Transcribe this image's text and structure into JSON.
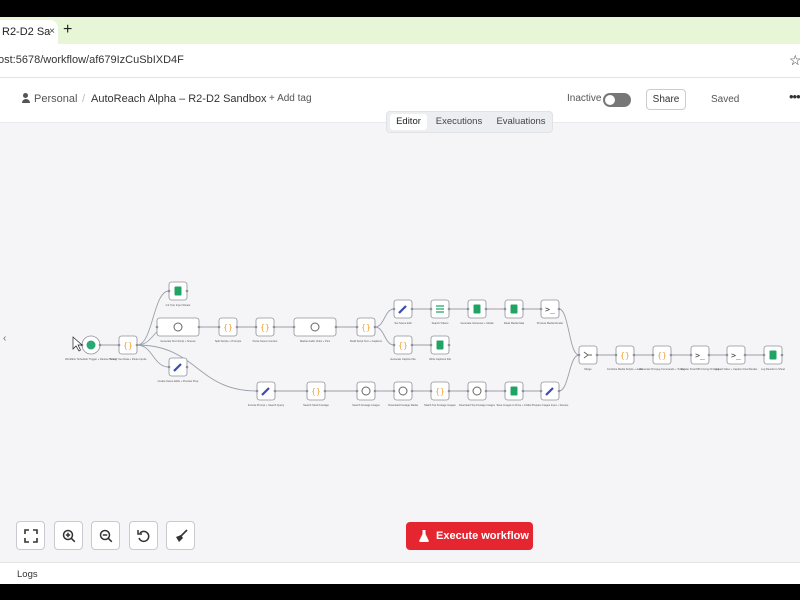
{
  "browser": {
    "tab_title": "R2-D2 Sa",
    "new_tab": "+",
    "close_glyph": "×",
    "url": "ost:5678/workflow/af679IzCuSbIXD4F",
    "bookmark_glyph": "☆"
  },
  "header": {
    "workspace": "Personal",
    "separator": "/",
    "workflow_title": "AutoReach Alpha – R2-D2 Sandbox",
    "add_tag": "+ Add tag",
    "status": "Inactive",
    "share": "Share",
    "saved": "Saved",
    "more_glyph": "•••"
  },
  "modes": [
    {
      "label": "Editor",
      "active": true
    },
    {
      "label": "Executions",
      "active": false
    },
    {
      "label": "Evaluations",
      "active": false
    }
  ],
  "canvas": {
    "collapse_glyph": "‹",
    "nodes": [
      {
        "kind": "trigger",
        "label": "Workflow 'Schedule' Trigger + Review Timing"
      },
      {
        "kind": "code",
        "label": "Select Your Data + Parse Inputs"
      },
      {
        "kind": "sheets",
        "label": "Init Your Input Sheets"
      },
      {
        "kind": "http",
        "label": "Generate Text Script + Scenes"
      },
      {
        "kind": "edit",
        "label": "Create Scene Edits + Preview Prep"
      },
      {
        "kind": "code",
        "label": "Split Scripts + Prompts"
      },
      {
        "kind": "code",
        "label": "Parse Scene Content"
      },
      {
        "kind": "http",
        "label": "Market Audio Voice + Pics"
      },
      {
        "kind": "code",
        "label": "Build Script Text + Captions"
      },
      {
        "kind": "edit",
        "label": "Set Scene Edit"
      },
      {
        "kind": "filter",
        "label": "Search Videos"
      },
      {
        "kind": "split",
        "label": "Generate Voiceover + Media"
      },
      {
        "kind": "sheets",
        "label": "Read Media Data"
      },
      {
        "kind": "exec",
        "label": "Process Media Render"
      },
      {
        "kind": "code",
        "label": "Generate Caption File"
      },
      {
        "kind": "sheets",
        "label": "Write Captions File"
      },
      {
        "kind": "edit",
        "label": "Format Prompt + Search Query"
      },
      {
        "kind": "code",
        "label": "Search Stock Footage"
      },
      {
        "kind": "http",
        "label": "Search Footage Images"
      },
      {
        "kind": "http",
        "label": "Download Footage Media"
      },
      {
        "kind": "code",
        "label": "Match Top Footage Images"
      },
      {
        "kind": "http",
        "label": "Download Top Footage Images"
      },
      {
        "kind": "sheets",
        "label": "Save Images to Drive + Folder"
      },
      {
        "kind": "edit",
        "label": "Prepare Images Input + Scenes"
      },
      {
        "kind": "merge",
        "label": "Merge"
      },
      {
        "kind": "code",
        "label": "Combine Media Scripts + Audio"
      },
      {
        "kind": "code",
        "label": "Generate FFmpeg Commands + Timing"
      },
      {
        "kind": "exec",
        "label": "Render Final MP4 Using FFmpeg"
      },
      {
        "kind": "exec",
        "label": "Upload Video + Caption Final Render"
      },
      {
        "kind": "sheets",
        "label": "Log Results to Sheet"
      }
    ]
  },
  "controls": [
    {
      "name": "fit-view",
      "icon": "fullscreen-icon"
    },
    {
      "name": "zoom-in",
      "icon": "zoom-in-icon"
    },
    {
      "name": "zoom-out",
      "icon": "zoom-out-icon"
    },
    {
      "name": "reset-zoom",
      "icon": "undo-icon"
    },
    {
      "name": "tidy-up",
      "icon": "broom-icon"
    }
  ],
  "execute": {
    "label": "Execute workflow",
    "color": "#e5252f"
  },
  "logs": {
    "label": "Logs"
  },
  "colors": {
    "sheets": "#20a464",
    "edit": "#3b4bb0",
    "code": "#f2a33a",
    "trigger": "#2aa876",
    "accent": "#e5252f"
  }
}
